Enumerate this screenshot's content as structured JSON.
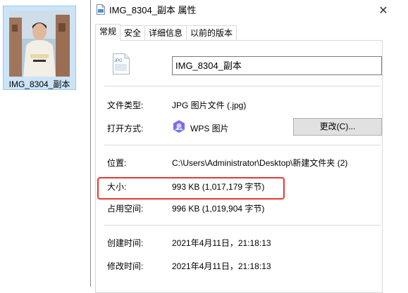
{
  "desktop": {
    "file_label": "IMG_8304_副本"
  },
  "window": {
    "title": "IMG_8304_副本 属性",
    "close_glyph": "✕"
  },
  "tabs": [
    {
      "label": "常规"
    },
    {
      "label": "安全"
    },
    {
      "label": "详细信息"
    },
    {
      "label": "以前的版本"
    }
  ],
  "general": {
    "file_name": "IMG_8304_副本",
    "file_icon_text": "JPG",
    "file_type_label": "文件类型:",
    "file_type_value": "JPG 图片文件 (.jpg)",
    "opens_with_label": "打开方式:",
    "opens_with_value": "WPS 图片",
    "change_button": "更改(C)...",
    "location_label": "位置:",
    "location_value": "C:\\Users\\Administrator\\Desktop\\新建文件夹 (2)",
    "size_label": "大小:",
    "size_value": "993 KB (1,017,179 字节)",
    "size_on_disk_label": "占用空间:",
    "size_on_disk_value": "996 KB (1,019,904 字节)",
    "created_label": "创建时间:",
    "created_value": "2021年4月11日，21:18:13",
    "modified_label": "修改时间:",
    "modified_value": "2021年4月11日，21:18:13"
  },
  "colors": {
    "highlight": "#e53935",
    "selection_bg": "#cce4f7",
    "button_bg": "#e1e1e1"
  }
}
